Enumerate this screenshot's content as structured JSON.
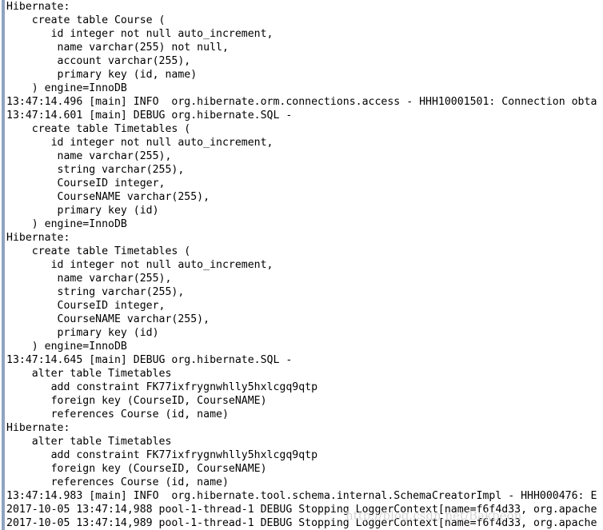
{
  "console": {
    "name": "console-log-output",
    "background_color": "#ffffff",
    "text_color": "#000000",
    "rail_color": "#8fa3c1",
    "watermark": "http://blog.csdn.net/Bakbeon",
    "watermark_color": "#cfcfcf",
    "lines": [
      "Hibernate: ",
      "    create table Course (",
      "       id integer not null auto_increment,",
      "        name varchar(255) not null,",
      "        account varchar(255),",
      "        primary key (id, name)",
      "    ) engine=InnoDB",
      "13:47:14.496 [main] INFO  org.hibernate.orm.connections.access - HHH10001501: Connection obta",
      "13:47:14.601 [main] DEBUG org.hibernate.SQL -",
      "    create table Timetables (",
      "       id integer not null auto_increment,",
      "        name varchar(255),",
      "        string varchar(255),",
      "        CourseID integer,",
      "        CourseNAME varchar(255),",
      "        primary key (id)",
      "    ) engine=InnoDB",
      "Hibernate: ",
      "    create table Timetables (",
      "       id integer not null auto_increment,",
      "        name varchar(255),",
      "        string varchar(255),",
      "        CourseID integer,",
      "        CourseNAME varchar(255),",
      "        primary key (id)",
      "    ) engine=InnoDB",
      "13:47:14.645 [main] DEBUG org.hibernate.SQL -",
      "    alter table Timetables ",
      "       add constraint FK77ixfrygnwhlly5hxlcgq9qtp ",
      "       foreign key (CourseID, CourseNAME) ",
      "       references Course (id, name)",
      "Hibernate: ",
      "    alter table Timetables ",
      "       add constraint FK77ixfrygnwhlly5hxlcgq9qtp ",
      "       foreign key (CourseID, CourseNAME) ",
      "       references Course (id, name)",
      "13:47:14.983 [main] INFO  org.hibernate.tool.schema.internal.SchemaCreatorImpl - HHH000476: E",
      "2017-10-05 13:47:14,988 pool-1-thread-1 DEBUG Stopping LoggerContext[name=f6f4d33, org.apache",
      "2017-10-05 13:47:14,989 pool-1-thread-1 DEBUG Stopping LoggerContext[name=f6f4d33, org.apache"
    ]
  }
}
